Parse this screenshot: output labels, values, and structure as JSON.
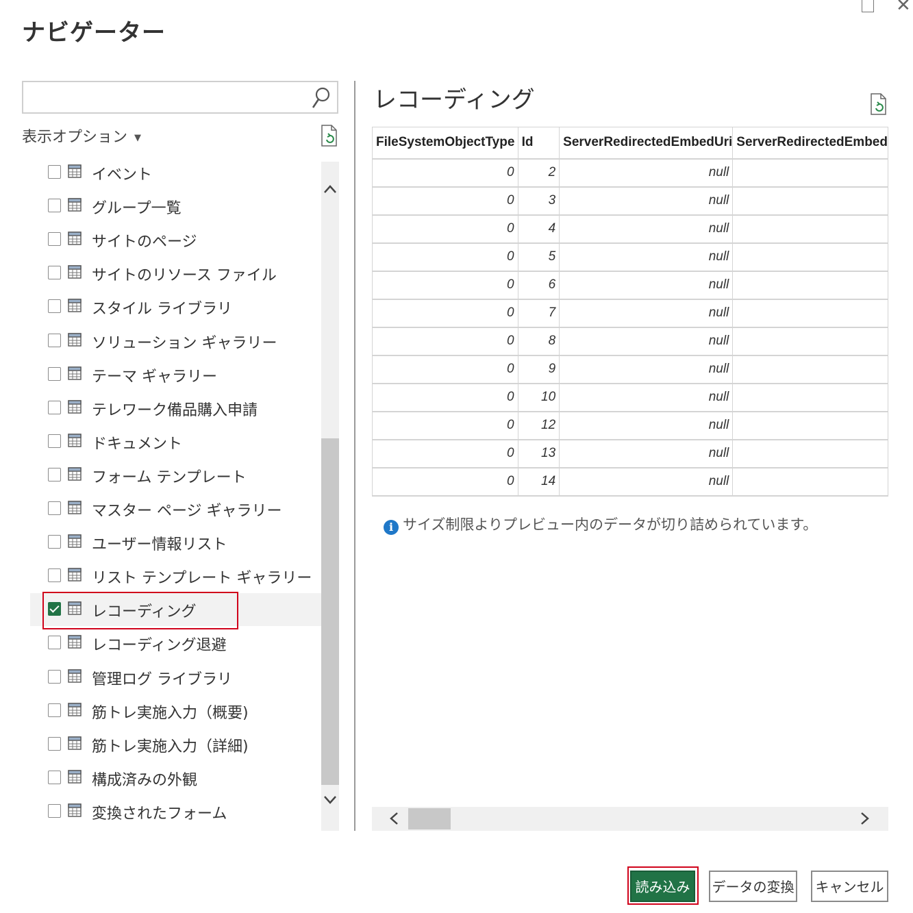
{
  "window": {
    "title": "ナビゲーター"
  },
  "search": {
    "placeholder": "",
    "value": ""
  },
  "display_options": {
    "label": "表示オプション"
  },
  "items": [
    {
      "label": "イベント",
      "checked": false
    },
    {
      "label": "グループ一覧",
      "checked": false
    },
    {
      "label": "サイトのページ",
      "checked": false
    },
    {
      "label": "サイトのリソース ファイル",
      "checked": false
    },
    {
      "label": "スタイル ライブラリ",
      "checked": false
    },
    {
      "label": "ソリューション ギャラリー",
      "checked": false
    },
    {
      "label": "テーマ ギャラリー",
      "checked": false
    },
    {
      "label": "テレワーク備品購入申請",
      "checked": false
    },
    {
      "label": "ドキュメント",
      "checked": false
    },
    {
      "label": "フォーム テンプレート",
      "checked": false
    },
    {
      "label": "マスター ページ ギャラリー",
      "checked": false
    },
    {
      "label": "ユーザー情報リスト",
      "checked": false
    },
    {
      "label": "リスト テンプレート ギャラリー",
      "checked": false
    },
    {
      "label": "レコーディング",
      "checked": true
    },
    {
      "label": "レコーディング退避",
      "checked": false
    },
    {
      "label": "管理ログ ライブラリ",
      "checked": false
    },
    {
      "label": "筋トレ実施入力（概要)",
      "checked": false
    },
    {
      "label": "筋トレ実施入力（詳細)",
      "checked": false
    },
    {
      "label": "構成済みの外観",
      "checked": false
    },
    {
      "label": "変換されたフォーム",
      "checked": false
    }
  ],
  "preview": {
    "title": "レコーディング",
    "columns": [
      "FileSystemObjectType",
      "Id",
      "ServerRedirectedEmbedUri",
      "ServerRedirectedEmbed"
    ],
    "rows": [
      [
        "0",
        "2",
        "null",
        ""
      ],
      [
        "0",
        "3",
        "null",
        ""
      ],
      [
        "0",
        "4",
        "null",
        ""
      ],
      [
        "0",
        "5",
        "null",
        ""
      ],
      [
        "0",
        "6",
        "null",
        ""
      ],
      [
        "0",
        "7",
        "null",
        ""
      ],
      [
        "0",
        "8",
        "null",
        ""
      ],
      [
        "0",
        "9",
        "null",
        ""
      ],
      [
        "0",
        "10",
        "null",
        ""
      ],
      [
        "0",
        "12",
        "null",
        ""
      ],
      [
        "0",
        "13",
        "null",
        ""
      ],
      [
        "0",
        "14",
        "null",
        ""
      ]
    ],
    "info": "サイズ制限よりプレビュー内のデータが切り詰められています。"
  },
  "footer": {
    "load_label": "読み込み",
    "transform_label": "データの変換",
    "cancel_label": "キャンセル"
  },
  "colors": {
    "accent": "#217346",
    "highlight": "#d0021b",
    "info": "#1f78c8"
  }
}
